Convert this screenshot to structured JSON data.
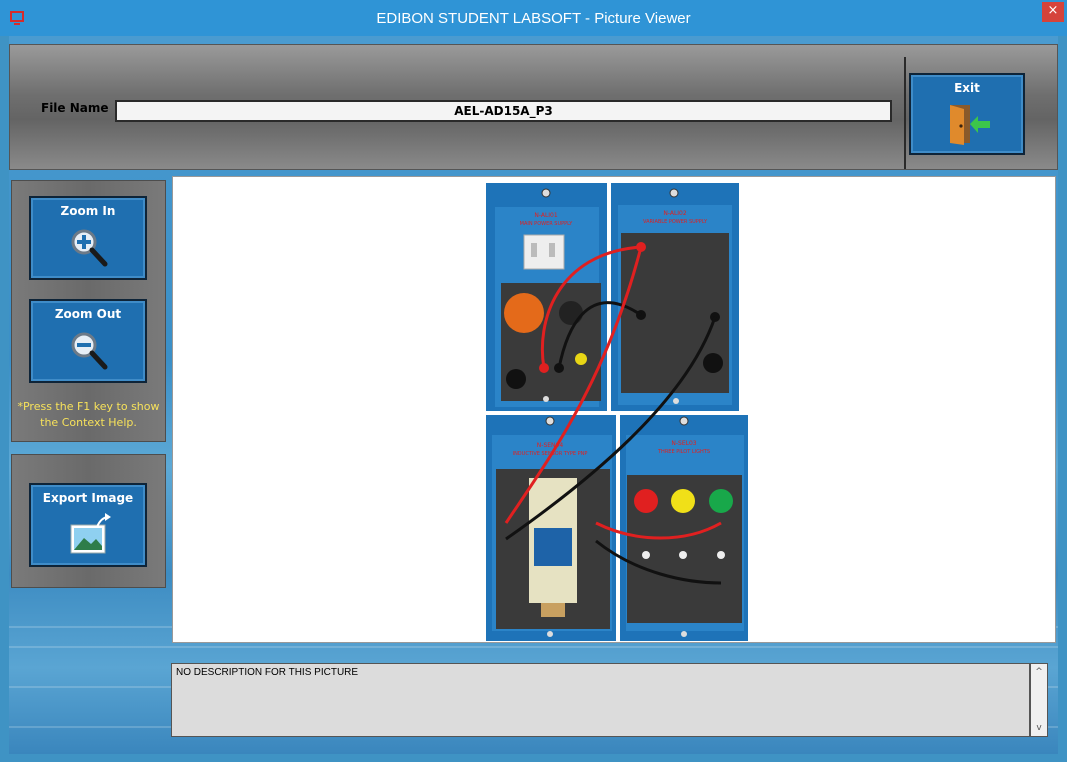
{
  "window": {
    "title": "EDIBON STUDENT LABSOFT - Picture Viewer",
    "close_glyph": "×"
  },
  "header": {
    "file_name_label": "File Name",
    "file_name_value": "AEL-AD15A_P3",
    "exit_label": "Exit",
    "exit_icon": "exit-door-icon"
  },
  "toolbar": {
    "zoom_in_label": "Zoom In",
    "zoom_out_label": "Zoom Out",
    "help_text": "*Press the F1 key to show the Context Help.",
    "export_label": "Export Image"
  },
  "picture": {
    "modules": [
      {
        "code": "N-ALI01",
        "name": "MAIN POWER SUPPLY"
      },
      {
        "code": "N-ALI02",
        "name": "VARIABLE POWER SUPPLY"
      },
      {
        "code": "N-SEN04",
        "name": "INDUCTIVE SENSOR TYPE PNP"
      },
      {
        "code": "N-SEL03",
        "name": "THREE PILOT LIGHTS"
      }
    ],
    "lamps": [
      "LAMP 1",
      "LAMP 2",
      "LAMP 3"
    ],
    "colors": {
      "panel": "#1e73b8",
      "cable_red": "#e0201d",
      "cable_black": "#111111"
    }
  },
  "description": {
    "text": "NO DESCRIPTION FOR THIS PICTURE",
    "scroll_up": "^",
    "scroll_down": "v"
  }
}
